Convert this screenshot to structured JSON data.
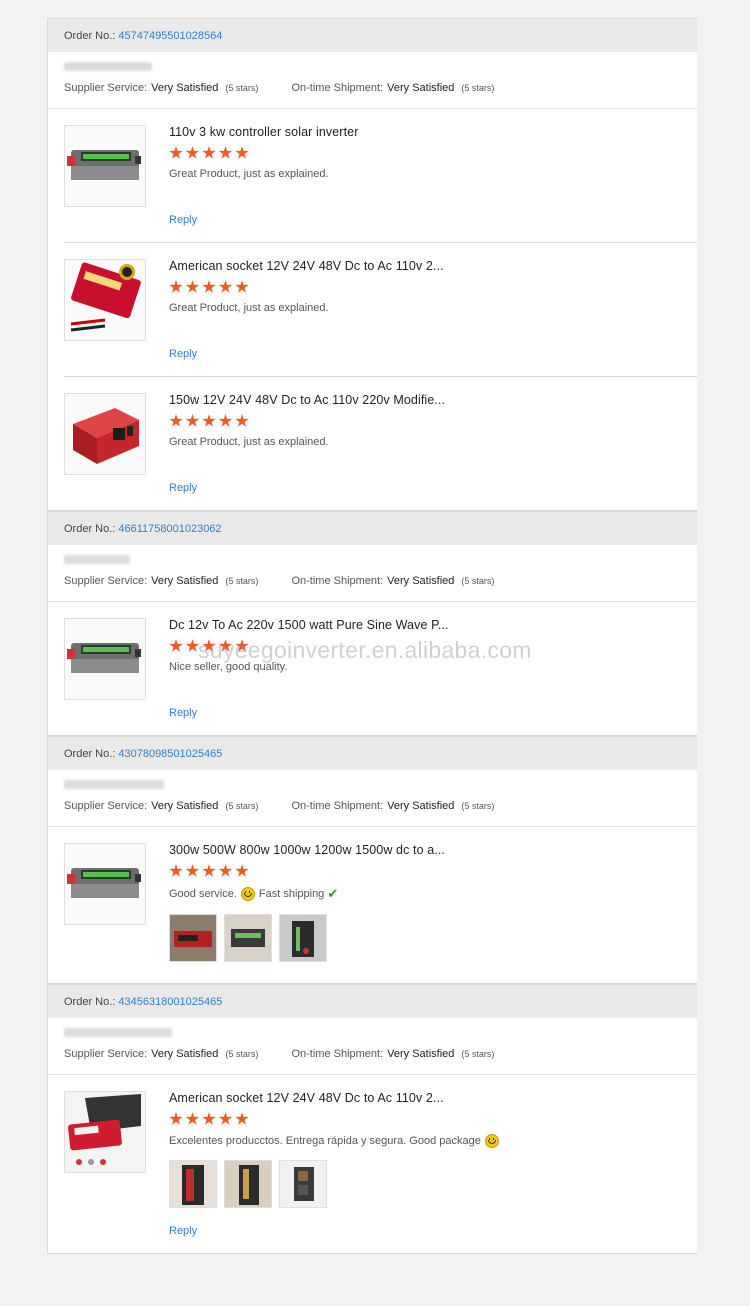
{
  "labels": {
    "order_no": "Order No.:",
    "supplier_service": "Supplier Service:",
    "on_time_shipment": "On-time Shipment:",
    "reply": "Reply"
  },
  "watermark": "suyeegoinverter.en.alibaba.com",
  "orders": [
    {
      "order_number": "45747495501028564",
      "supplier_rating": "Very Satisfied",
      "supplier_stars": "(5 stars)",
      "shipment_rating": "Very Satisfied",
      "shipment_stars": "(5 stars)",
      "items": [
        {
          "title": "110v 3 kw controller solar inverter",
          "stars": 5,
          "review": "Great Product, just as explained.",
          "reply": true,
          "image": "gray-inverter-icon"
        },
        {
          "title": "American socket 12V 24V 48V Dc to Ac 110v 2...",
          "stars": 5,
          "review": "Great Product, just as explained.",
          "reply": true,
          "image": "red-inverter-icon"
        },
        {
          "title": "150w 12V 24V 48V Dc to Ac 110v 220v Modifie...",
          "stars": 5,
          "review": "Great Product, just as explained.",
          "reply": true,
          "image": "red-box-inverter-icon"
        }
      ]
    },
    {
      "order_number": "46611758001023062",
      "supplier_rating": "Very Satisfied",
      "supplier_stars": "(5 stars)",
      "shipment_rating": "Very Satisfied",
      "shipment_stars": "(5 stars)",
      "items": [
        {
          "title": "Dc 12v To Ac 220v 1500 watt Pure Sine Wave P...",
          "stars": 5,
          "review": "Nice seller, good quality.",
          "reply": true,
          "image": "gray-inverter-icon"
        }
      ]
    },
    {
      "order_number": "43078098501025465",
      "supplier_rating": "Very Satisfied",
      "supplier_stars": "(5 stars)",
      "shipment_rating": "Very Satisfied",
      "shipment_stars": "(5 stars)",
      "items": [
        {
          "title": "300w 500W 800w 1000w 1200w 1500w dc to a...",
          "stars": 5,
          "review_parts": [
            "Good service.",
            "Fast shipping"
          ],
          "reply": false,
          "image": "gray-inverter-icon",
          "photos": 3
        }
      ]
    },
    {
      "order_number": "43456318001025465",
      "supplier_rating": "Very Satisfied",
      "supplier_stars": "(5 stars)",
      "shipment_rating": "Very Satisfied",
      "shipment_stars": "(5 stars)",
      "items": [
        {
          "title": "American socket 12V 24V 48V Dc to Ac 110v 2...",
          "stars": 5,
          "review_parts": [
            "Excelentes producctos.  Entrega rápida y segura.  Good package"
          ],
          "reply": true,
          "image": "red-inverter-laptop-icon",
          "photos": 3
        }
      ]
    }
  ]
}
